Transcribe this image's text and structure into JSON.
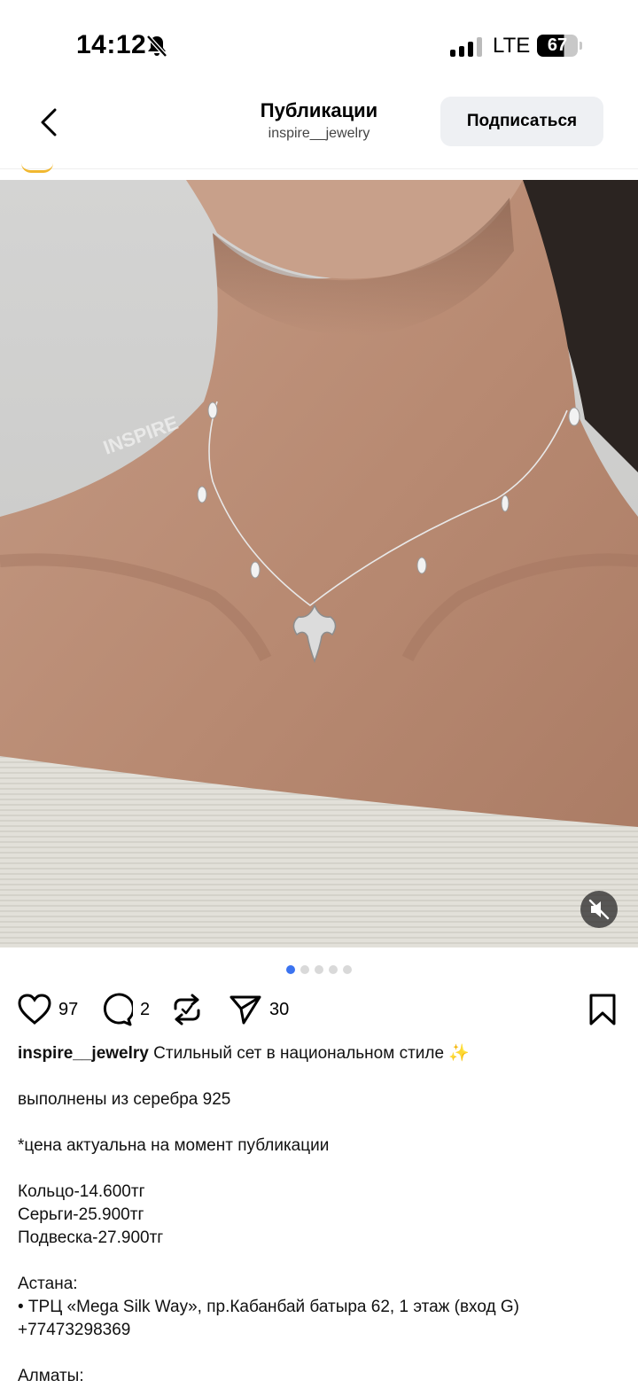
{
  "status_bar": {
    "time": "14:12",
    "network": "LTE",
    "battery": "67"
  },
  "header": {
    "title": "Публикации",
    "subtitle": "inspire__jewelry",
    "follow_label": "Подписаться"
  },
  "photo": {
    "watermark": "INSPIRE",
    "slide_count": 5,
    "active_slide": 1
  },
  "actions": {
    "likes": "97",
    "comments": "2",
    "shares": "30"
  },
  "caption": {
    "username": "inspire__jewelry",
    "text": "Стильный сет в национальном стиле ✨",
    "lines": [
      "",
      "выполнены из серебра 925",
      "",
      "*цена актуальна на момент публикации",
      "",
      "Кольцо-14.600тг",
      "Серьги-25.900тг",
      "Подвеска-27.900тг",
      "",
      "Астана:",
      "• ТРЦ «Mega Silk Way», пр.Кабанбай батыра 62, 1 этаж (вход G)",
      "+77473298369",
      "",
      "Алматы:"
    ]
  },
  "colors": {
    "accent": "#3b73f0",
    "follow_bg": "#eef0f3",
    "sparkle": "#f5c542"
  }
}
